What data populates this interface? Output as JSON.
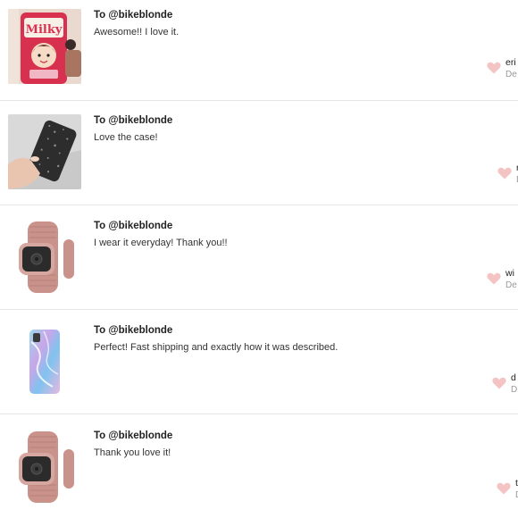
{
  "reviews": [
    {
      "recipient": "To @bikeblonde",
      "message": "Awesome!! I love it.",
      "user": "eri",
      "date": "De",
      "product_image": "milky-candy-phone-case"
    },
    {
      "recipient": "To @bikeblonde",
      "message": "Love the case!",
      "user": "r",
      "date": "D",
      "product_image": "black-glitter-phone-case"
    },
    {
      "recipient": "To @bikeblonde",
      "message": "I wear it everyday! Thank you!!",
      "user": "wi",
      "date": "De",
      "product_image": "rose-gold-milanese-watch-band"
    },
    {
      "recipient": "To @bikeblonde",
      "message": "Perfect! Fast shipping and exactly how it was described.",
      "user": "d",
      "date": "D",
      "product_image": "iridescent-marble-phone-case"
    },
    {
      "recipient": "To @bikeblonde",
      "message": "Thank you love it!",
      "user": "t",
      "date": "D",
      "product_image": "rose-gold-milanese-watch-band"
    }
  ],
  "colors": {
    "heart": "#f4c4c4",
    "divider": "#e6e6e6",
    "date_text": "#999999"
  }
}
